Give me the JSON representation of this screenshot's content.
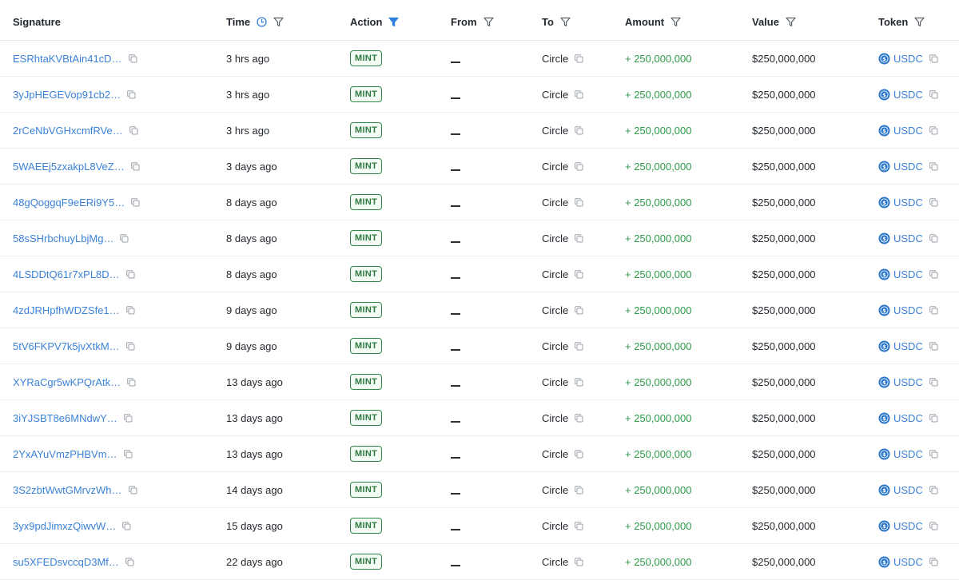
{
  "columns": {
    "signature": "Signature",
    "time": "Time",
    "action": "Action",
    "from": "From",
    "to": "To",
    "amount": "Amount",
    "value": "Value",
    "token": "Token"
  },
  "header_icons": {
    "time": [
      "clock-icon",
      "filter-icon"
    ],
    "action": [
      "filter-icon-active"
    ],
    "from": [
      "filter-icon"
    ],
    "to": [
      "filter-icon"
    ],
    "amount": [
      "filter-icon"
    ],
    "value": [
      "filter-icon"
    ],
    "token": [
      "filter-icon"
    ]
  },
  "colors": {
    "link": "#3b82d9",
    "amount_positive": "#2e9b4a",
    "badge_border": "#2f8a47",
    "filter_active": "#2f7fe0"
  },
  "rows": [
    {
      "signature": "ESRhtaKVBtAin41cD…",
      "time": "3 hrs ago",
      "action": "MINT",
      "from": "__",
      "to": "Circle",
      "amount": "+ 250,000,000",
      "value": "$250,000,000",
      "token": "USDC"
    },
    {
      "signature": "3yJpHEGEVop91cb2…",
      "time": "3 hrs ago",
      "action": "MINT",
      "from": "__",
      "to": "Circle",
      "amount": "+ 250,000,000",
      "value": "$250,000,000",
      "token": "USDC"
    },
    {
      "signature": "2rCeNbVGHxcmfRVe…",
      "time": "3 hrs ago",
      "action": "MINT",
      "from": "__",
      "to": "Circle",
      "amount": "+ 250,000,000",
      "value": "$250,000,000",
      "token": "USDC"
    },
    {
      "signature": "5WAEEj5zxakpL8VeZ…",
      "time": "3 days ago",
      "action": "MINT",
      "from": "__",
      "to": "Circle",
      "amount": "+ 250,000,000",
      "value": "$250,000,000",
      "token": "USDC"
    },
    {
      "signature": "48gQoggqF9eERi9Y5…",
      "time": "8 days ago",
      "action": "MINT",
      "from": "__",
      "to": "Circle",
      "amount": "+ 250,000,000",
      "value": "$250,000,000",
      "token": "USDC"
    },
    {
      "signature": "58sSHrbchuyLbjMg…",
      "time": "8 days ago",
      "action": "MINT",
      "from": "__",
      "to": "Circle",
      "amount": "+ 250,000,000",
      "value": "$250,000,000",
      "token": "USDC"
    },
    {
      "signature": "4LSDDtQ61r7xPL8D…",
      "time": "8 days ago",
      "action": "MINT",
      "from": "__",
      "to": "Circle",
      "amount": "+ 250,000,000",
      "value": "$250,000,000",
      "token": "USDC"
    },
    {
      "signature": "4zdJRHpfhWDZSfe1…",
      "time": "9 days ago",
      "action": "MINT",
      "from": "__",
      "to": "Circle",
      "amount": "+ 250,000,000",
      "value": "$250,000,000",
      "token": "USDC"
    },
    {
      "signature": "5tV6FKPV7k5jvXtkM…",
      "time": "9 days ago",
      "action": "MINT",
      "from": "__",
      "to": "Circle",
      "amount": "+ 250,000,000",
      "value": "$250,000,000",
      "token": "USDC"
    },
    {
      "signature": "XYRaCgr5wKPQrAtk…",
      "time": "13 days ago",
      "action": "MINT",
      "from": "__",
      "to": "Circle",
      "amount": "+ 250,000,000",
      "value": "$250,000,000",
      "token": "USDC"
    },
    {
      "signature": "3iYJSBT8e6MNdwY…",
      "time": "13 days ago",
      "action": "MINT",
      "from": "__",
      "to": "Circle",
      "amount": "+ 250,000,000",
      "value": "$250,000,000",
      "token": "USDC"
    },
    {
      "signature": "2YxAYuVmzPHBVm…",
      "time": "13 days ago",
      "action": "MINT",
      "from": "__",
      "to": "Circle",
      "amount": "+ 250,000,000",
      "value": "$250,000,000",
      "token": "USDC"
    },
    {
      "signature": "3S2zbtWwtGMrvzWh…",
      "time": "14 days ago",
      "action": "MINT",
      "from": "__",
      "to": "Circle",
      "amount": "+ 250,000,000",
      "value": "$250,000,000",
      "token": "USDC"
    },
    {
      "signature": "3yx9pdJimxzQiwvW…",
      "time": "15 days ago",
      "action": "MINT",
      "from": "__",
      "to": "Circle",
      "amount": "+ 250,000,000",
      "value": "$250,000,000",
      "token": "USDC"
    },
    {
      "signature": "su5XFEDsvccqD3Mf…",
      "time": "22 days ago",
      "action": "MINT",
      "from": "__",
      "to": "Circle",
      "amount": "+ 250,000,000",
      "value": "$250,000,000",
      "token": "USDC"
    }
  ]
}
